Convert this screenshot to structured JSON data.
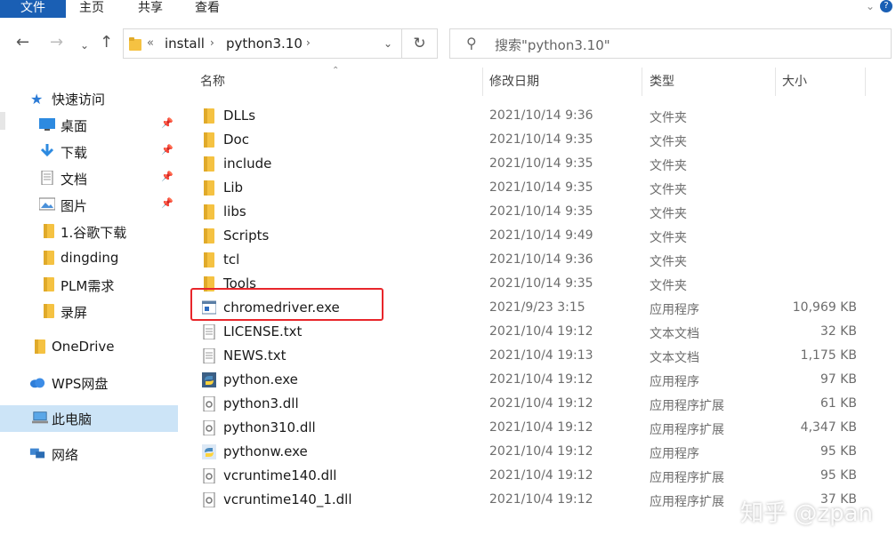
{
  "ribbon": {
    "tabs": [
      "文件",
      "主页",
      "共享",
      "查看"
    ]
  },
  "nav": {
    "breadcrumb_overflow": "«",
    "breadcrumb": [
      "install",
      "python3.10"
    ],
    "search_placeholder": "搜索\"python3.10\""
  },
  "sidebar": {
    "items": [
      {
        "label": "快速访问",
        "icon": "star-icon",
        "pinned": false
      },
      {
        "label": "桌面",
        "icon": "desktop-icon",
        "pinned": true
      },
      {
        "label": "下载",
        "icon": "download-arrow-icon",
        "pinned": true
      },
      {
        "label": "文档",
        "icon": "document-icon",
        "pinned": true
      },
      {
        "label": "图片",
        "icon": "picture-icon",
        "pinned": true
      },
      {
        "label": "1.谷歌下载",
        "icon": "folder-icon",
        "pinned": false
      },
      {
        "label": "dingding",
        "icon": "folder-icon",
        "pinned": false
      },
      {
        "label": "PLM需求",
        "icon": "folder-icon",
        "pinned": false
      },
      {
        "label": "录屏",
        "icon": "folder-icon",
        "pinned": false
      },
      {
        "label": "OneDrive",
        "icon": "folder-icon",
        "pinned": false
      },
      {
        "label": "WPS网盘",
        "icon": "cloud-icon",
        "pinned": false
      },
      {
        "label": "此电脑",
        "icon": "computer-icon",
        "pinned": false,
        "selected": true
      },
      {
        "label": "网络",
        "icon": "network-icon",
        "pinned": false
      }
    ]
  },
  "columns": {
    "name": "名称",
    "date": "修改日期",
    "type": "类型",
    "size": "大小"
  },
  "files": [
    {
      "name": "DLLs",
      "date": "2021/10/14 9:36",
      "type": "文件夹",
      "size": "",
      "icon": "folder-icon"
    },
    {
      "name": "Doc",
      "date": "2021/10/14 9:35",
      "type": "文件夹",
      "size": "",
      "icon": "folder-icon"
    },
    {
      "name": "include",
      "date": "2021/10/14 9:35",
      "type": "文件夹",
      "size": "",
      "icon": "folder-icon"
    },
    {
      "name": "Lib",
      "date": "2021/10/14 9:35",
      "type": "文件夹",
      "size": "",
      "icon": "folder-icon"
    },
    {
      "name": "libs",
      "date": "2021/10/14 9:35",
      "type": "文件夹",
      "size": "",
      "icon": "folder-icon"
    },
    {
      "name": "Scripts",
      "date": "2021/10/14 9:49",
      "type": "文件夹",
      "size": "",
      "icon": "folder-icon"
    },
    {
      "name": "tcl",
      "date": "2021/10/14 9:36",
      "type": "文件夹",
      "size": "",
      "icon": "folder-icon"
    },
    {
      "name": "Tools",
      "date": "2021/10/14 9:35",
      "type": "文件夹",
      "size": "",
      "icon": "folder-icon"
    },
    {
      "name": "chromedriver.exe",
      "date": "2021/9/23 3:15",
      "type": "应用程序",
      "size": "10,969 KB",
      "icon": "exe-window-icon",
      "highlighted": true
    },
    {
      "name": "LICENSE.txt",
      "date": "2021/10/4 19:12",
      "type": "文本文档",
      "size": "32 KB",
      "icon": "text-file-icon"
    },
    {
      "name": "NEWS.txt",
      "date": "2021/10/4 19:13",
      "type": "文本文档",
      "size": "1,175 KB",
      "icon": "text-file-icon"
    },
    {
      "name": "python.exe",
      "date": "2021/10/4 19:12",
      "type": "应用程序",
      "size": "97 KB",
      "icon": "python-icon"
    },
    {
      "name": "python3.dll",
      "date": "2021/10/4 19:12",
      "type": "应用程序扩展",
      "size": "61 KB",
      "icon": "dll-gear-icon"
    },
    {
      "name": "python310.dll",
      "date": "2021/10/4 19:12",
      "type": "应用程序扩展",
      "size": "4,347 KB",
      "icon": "dll-gear-icon"
    },
    {
      "name": "pythonw.exe",
      "date": "2021/10/4 19:12",
      "type": "应用程序",
      "size": "95 KB",
      "icon": "python-icon"
    },
    {
      "name": "vcruntime140.dll",
      "date": "2021/10/4 19:12",
      "type": "应用程序扩展",
      "size": "95 KB",
      "icon": "dll-gear-icon"
    },
    {
      "name": "vcruntime140_1.dll",
      "date": "2021/10/4 19:12",
      "type": "应用程序扩展",
      "size": "37 KB",
      "icon": "dll-gear-icon"
    }
  ],
  "watermark": "知乎 @zpan",
  "colors": {
    "file_tab": "#1a5fb4",
    "folder": "#f5c242",
    "selection": "#cce4f7",
    "highlight_box": "#e8262b"
  }
}
